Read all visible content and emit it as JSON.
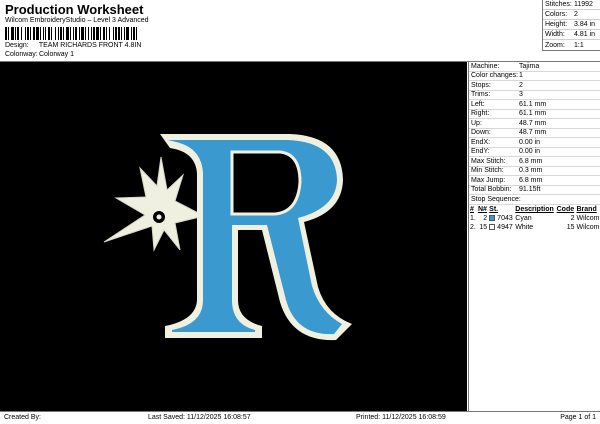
{
  "header": {
    "title": "Production Worksheet",
    "subtitle": "Wilcom EmbroideryStudio – Level 3 Advanced",
    "design_label": "Design:",
    "design_value": "TEAM RICHARDS FRONT 4.8IN",
    "colorway_label": "Colonway:",
    "colorway_value": "Colorway 1"
  },
  "summary": [
    {
      "label": "Stitches:",
      "value": "11992"
    },
    {
      "label": "Colors:",
      "value": "2"
    },
    {
      "label": "Height:",
      "value": "3.84 in"
    },
    {
      "label": "Width:",
      "value": "4.81 in"
    },
    {
      "label": "Zoom:",
      "value": "1:1"
    }
  ],
  "machine_props": [
    {
      "label": "Machine:",
      "value": "Tajima"
    },
    {
      "label": "Color changes:",
      "value": "1"
    },
    {
      "label": "Stops:",
      "value": "2"
    },
    {
      "label": "Trims:",
      "value": "3"
    },
    {
      "label": "Left:",
      "value": "61.1 mm"
    },
    {
      "label": "Right:",
      "value": "61.1 mm"
    },
    {
      "label": "Up:",
      "value": "48.7 mm"
    },
    {
      "label": "Down:",
      "value": "48.7 mm"
    },
    {
      "label": "EndX:",
      "value": "0.00 in"
    },
    {
      "label": "EndY:",
      "value": "0.00 in"
    },
    {
      "label": "Max Stitch:",
      "value": "6.8 mm"
    },
    {
      "label": "Min Stitch:",
      "value": "0.3 mm"
    },
    {
      "label": "Max Jump:",
      "value": "6.8 mm"
    },
    {
      "label": "Total Bobbin:",
      "value": "91.15ft"
    }
  ],
  "stop_sequence": {
    "title": "Stop Sequence:",
    "headers": [
      "#",
      "N#",
      "St.",
      "Description",
      "Code",
      "Brand"
    ],
    "rows": [
      {
        "num": "1.",
        "n": "2",
        "swatch": "#3a9ad0",
        "st": "7043",
        "desc": "Cyan",
        "code": "2",
        "brand": "Wilcom"
      },
      {
        "num": "2.",
        "n": "15",
        "swatch": "#ffffff",
        "st": "4947",
        "desc": "White",
        "code": "15",
        "brand": "Wilcom"
      }
    ]
  },
  "footer": {
    "created": "Created By:",
    "last_saved": "Last Saved: 11/12/2025 16:08:57",
    "printed": "Printed: 11/12/2025 16:08:59",
    "page": "Page 1 of 1"
  },
  "colors": {
    "background": "#000000",
    "thread_cyan": "#3a9ad0",
    "thread_white": "#f0f0e0"
  }
}
